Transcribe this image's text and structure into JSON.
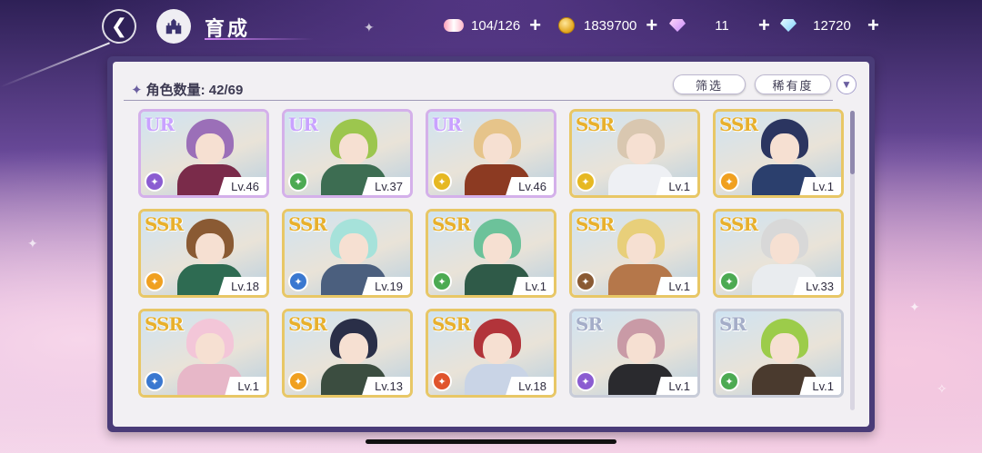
{
  "header": {
    "title": "育成"
  },
  "resources": [
    {
      "name": "candy",
      "icon": "candy-icon",
      "value": "104/126"
    },
    {
      "name": "gold",
      "icon": "coin-icon",
      "value": "1839700"
    },
    {
      "name": "pink-gem",
      "icon": "pink-diamond-icon",
      "value": "11"
    },
    {
      "name": "blue-gem",
      "icon": "blue-diamond-icon",
      "value": "12720"
    }
  ],
  "plus_label": "+",
  "panel": {
    "count_label": "角色数量:",
    "count_value": "42/69",
    "filter_label": "筛选",
    "sort_label": "稀有度",
    "sort_toggle": "▼"
  },
  "characters": [
    {
      "rarity": "UR",
      "level": "Lv.46",
      "attr_color": "#8b5cd1",
      "hair": "#9b6fb8",
      "outfit": "#7a2b4a"
    },
    {
      "rarity": "UR",
      "level": "Lv.37",
      "attr_color": "#4caa52",
      "hair": "#9cc64e",
      "outfit": "#3d6d52"
    },
    {
      "rarity": "UR",
      "level": "Lv.46",
      "attr_color": "#e6b822",
      "hair": "#e6c48a",
      "outfit": "#8c3a22"
    },
    {
      "rarity": "SSR",
      "level": "Lv.1",
      "attr_color": "#e6b822",
      "hair": "#d9c7b0",
      "outfit": "#eef0f4"
    },
    {
      "rarity": "SSR",
      "level": "Lv.1",
      "attr_color": "#f0a020",
      "hair": "#2b3560",
      "outfit": "#2b3f6d"
    },
    {
      "rarity": "SSR",
      "level": "Lv.18",
      "attr_color": "#f0a020",
      "hair": "#8a5a33",
      "outfit": "#2e6b52"
    },
    {
      "rarity": "SSR",
      "level": "Lv.19",
      "attr_color": "#3a78d0",
      "hair": "#a6e2da",
      "outfit": "#4b5f7e"
    },
    {
      "rarity": "SSR",
      "level": "Lv.1",
      "attr_color": "#4caa52",
      "hair": "#6cc29a",
      "outfit": "#2f5a48"
    },
    {
      "rarity": "SSR",
      "level": "Lv.1",
      "attr_color": "#8a5a33",
      "hair": "#e8cf7a",
      "outfit": "#b5774a"
    },
    {
      "rarity": "SSR",
      "level": "Lv.33",
      "attr_color": "#4caa52",
      "hair": "#d8d8d8",
      "outfit": "#e9ecef"
    },
    {
      "rarity": "SSR",
      "level": "Lv.1",
      "attr_color": "#3a78d0",
      "hair": "#f3c6d8",
      "outfit": "#e7b7c8"
    },
    {
      "rarity": "SSR",
      "level": "Lv.13",
      "attr_color": "#f0a020",
      "hair": "#2a2f48",
      "outfit": "#3b4d40"
    },
    {
      "rarity": "SSR",
      "level": "Lv.18",
      "attr_color": "#e0542c",
      "hair": "#b2343a",
      "outfit": "#c9d4e6"
    },
    {
      "rarity": "SR",
      "level": "Lv.1",
      "attr_color": "#8b5cd1",
      "hair": "#c99aa6",
      "outfit": "#2a2a2e"
    },
    {
      "rarity": "SR",
      "level": "Lv.1",
      "attr_color": "#4caa52",
      "hair": "#9ccc4a",
      "outfit": "#4a3a2e"
    }
  ]
}
